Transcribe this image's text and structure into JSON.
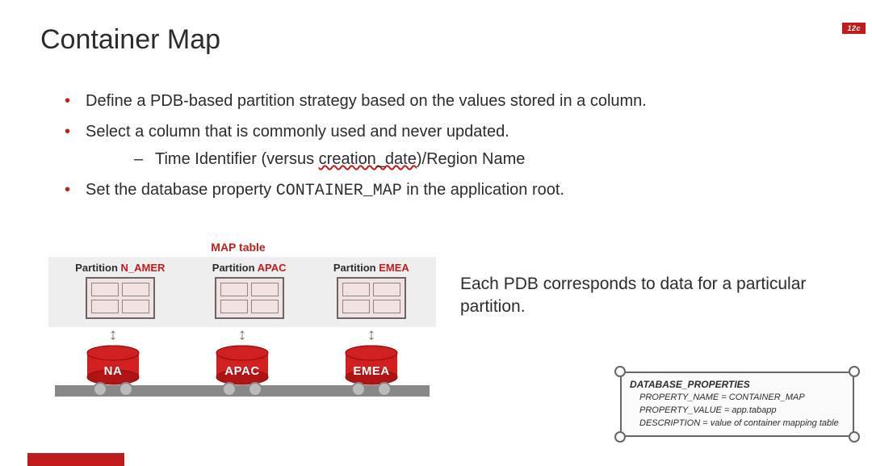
{
  "badge": "12c",
  "title": "Container Map",
  "bullets": [
    {
      "text": "Define a PDB-based partition strategy based on the values stored in a column."
    },
    {
      "text": "Select a column that is commonly used and never updated.",
      "sub": {
        "prefix": "Time Identifier (versus ",
        "wavy": "creation_date",
        "suffix": ")/Region Name"
      }
    },
    {
      "pre": "Set the database property ",
      "code": "CONTAINER_MAP",
      "post": " in the application root."
    }
  ],
  "map_title": "MAP table",
  "plabel_prefix": "Partition ",
  "partitions": [
    {
      "name": "N_AMER",
      "db": "NA"
    },
    {
      "name": "APAC",
      "db": "APAC"
    },
    {
      "name": "EMEA",
      "db": "EMEA"
    }
  ],
  "caption": "Each PDB corresponds to data for a particular partition.",
  "props": {
    "heading": "DATABASE_PROPERTIES",
    "rows": [
      "PROPERTY_NAME = CONTAINER_MAP",
      "PROPERTY_VALUE = app.tabapp",
      "DESCRIPTION = value of container mapping table"
    ]
  }
}
